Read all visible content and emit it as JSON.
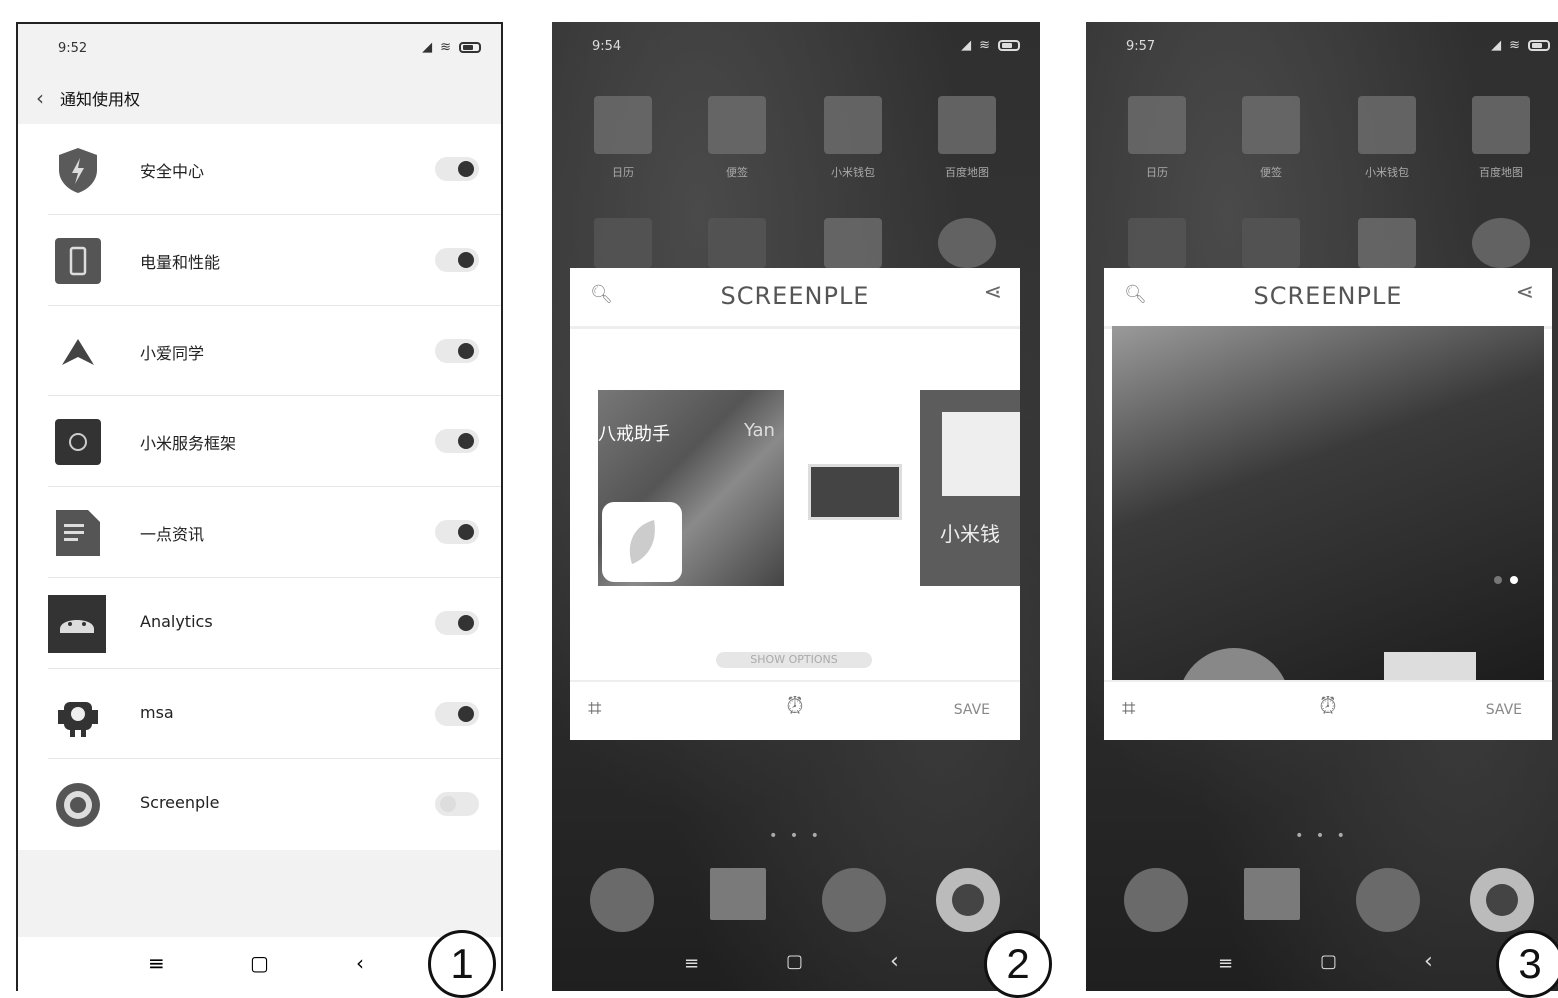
{
  "panel1": {
    "time": "9:52",
    "title": "通知使用权",
    "items": [
      {
        "label": "安全中心",
        "icon": "shield-icon",
        "on": true
      },
      {
        "label": "电量和性能",
        "icon": "battery-app-icon",
        "on": true
      },
      {
        "label": "小爱同学",
        "icon": "xiaoai-icon",
        "on": true
      },
      {
        "label": "小米服务框架",
        "icon": "framework-icon",
        "on": true
      },
      {
        "label": "一点资讯",
        "icon": "news-icon",
        "on": true
      },
      {
        "label": "Analytics",
        "icon": "android-icon",
        "on": true
      },
      {
        "label": "msa",
        "icon": "msa-icon",
        "on": true
      },
      {
        "label": "Screenple",
        "icon": "screenple-icon",
        "on": false
      }
    ],
    "badge": "1"
  },
  "panel2": {
    "time": "9:54",
    "home_labels": [
      "日历",
      "便签",
      "小米钱包",
      "百度地图"
    ],
    "card": {
      "title": "SCREENPLE",
      "thumb1_text": "八戒助手",
      "thumb1_text2": "Yan",
      "thumb3_text": "小米钱",
      "show_options": "SHOW OPTIONS",
      "save": "SAVE"
    },
    "badge": "2"
  },
  "panel3": {
    "time": "9:57",
    "home_labels": [
      "日历",
      "便签",
      "小米钱包",
      "百度地图"
    ],
    "card": {
      "title": "SCREENPLE",
      "save": "SAVE"
    },
    "badge": "3"
  }
}
